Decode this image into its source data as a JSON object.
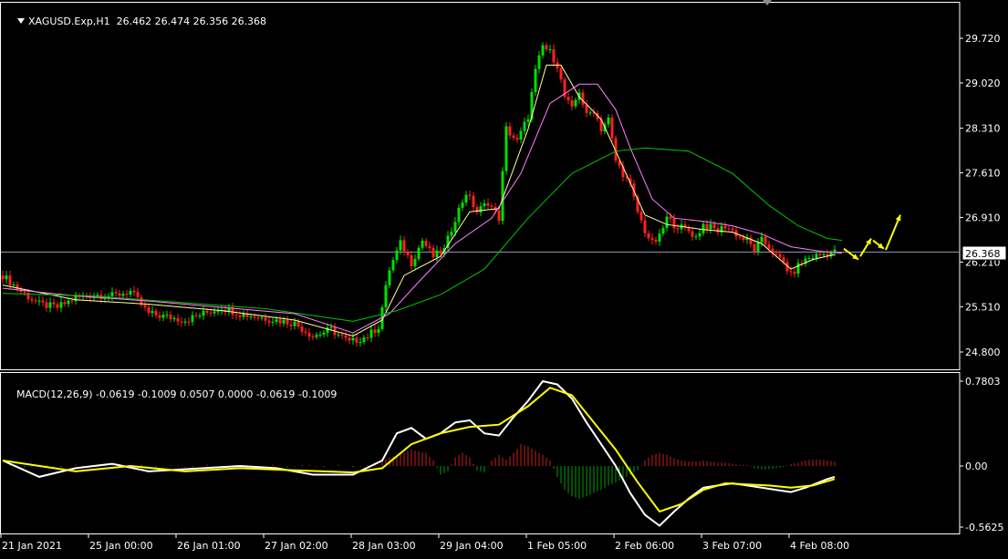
{
  "symbol_title": "XAGUSD.Exp,H1",
  "ohlc": "26.462 26.474 26.356 26.368",
  "macd_title": "MACD(12,26,9) -0.0619 -0.1009 0.0507 0.0000 -0.0619 -0.1009",
  "current_price": "26.368",
  "colors": {
    "background": "#000000",
    "bull_candle": "#00e000",
    "bear_candle": "#ff2020",
    "ma_fast": "#ffffa0",
    "ma_mid": "#ff80ff",
    "ma_slow": "#00c800",
    "macd_line": "#ffffff",
    "signal_line": "#ffff00",
    "hist_up": "#c81e1e",
    "hist_down": "#00a000",
    "forecast_arrow": "#ffff00",
    "price_line": "#8fa0b0"
  },
  "chart_data": [
    {
      "type": "candlestick",
      "title": "XAGUSD.Exp,H1",
      "y_ticks": [
        "29.720",
        "29.020",
        "28.310",
        "27.610",
        "26.910",
        "26.210",
        "25.510",
        "24.800"
      ],
      "ylim": [
        24.59,
        30.11
      ],
      "x_ticks": [
        "21 Jan 2021",
        "25 Jan 00:00",
        "26 Jan 01:00",
        "27 Jan 02:00",
        "28 Jan 03:00",
        "29 Jan 04:00",
        "1 Feb 05:00",
        "2 Feb 06:00",
        "3 Feb 07:00",
        "4 Feb 08:00"
      ],
      "x_tick_index": [
        0,
        24,
        48,
        72,
        96,
        120,
        144,
        168,
        192,
        216
      ],
      "close_path": [
        [
          0,
          26.0
        ],
        [
          5,
          25.75
        ],
        [
          10,
          25.55
        ],
        [
          15,
          25.5
        ],
        [
          20,
          25.65
        ],
        [
          25,
          25.7
        ],
        [
          30,
          25.68
        ],
        [
          35,
          25.75
        ],
        [
          40,
          25.4
        ],
        [
          45,
          25.35
        ],
        [
          50,
          25.3
        ],
        [
          55,
          25.4
        ],
        [
          60,
          25.5
        ],
        [
          65,
          25.4
        ],
        [
          70,
          25.35
        ],
        [
          75,
          25.3
        ],
        [
          80,
          25.25
        ],
        [
          85,
          25.05
        ],
        [
          90,
          25.15
        ],
        [
          95,
          24.95
        ],
        [
          100,
          25.05
        ],
        [
          103,
          25.2
        ],
        [
          106,
          26.1
        ],
        [
          109,
          26.5
        ],
        [
          112,
          26.2
        ],
        [
          115,
          26.55
        ],
        [
          118,
          26.3
        ],
        [
          121,
          26.4
        ],
        [
          124,
          26.9
        ],
        [
          127,
          27.3
        ],
        [
          130,
          27.0
        ],
        [
          133,
          27.15
        ],
        [
          136,
          26.9
        ],
        [
          138,
          28.3
        ],
        [
          141,
          28.1
        ],
        [
          144,
          28.5
        ],
        [
          146,
          29.2
        ],
        [
          148,
          29.6
        ],
        [
          150,
          29.5
        ],
        [
          152,
          29.3
        ],
        [
          154,
          28.8
        ],
        [
          156,
          28.6
        ],
        [
          158,
          28.9
        ],
        [
          160,
          28.5
        ],
        [
          162,
          28.6
        ],
        [
          164,
          28.3
        ],
        [
          166,
          28.45
        ],
        [
          168,
          27.8
        ],
        [
          170,
          27.6
        ],
        [
          172,
          27.4
        ],
        [
          174,
          27.0
        ],
        [
          176,
          26.7
        ],
        [
          178,
          26.5
        ],
        [
          180,
          26.6
        ],
        [
          182,
          26.9
        ],
        [
          184,
          26.8
        ],
        [
          186,
          26.75
        ],
        [
          188,
          26.7
        ],
        [
          190,
          26.6
        ],
        [
          192,
          26.8
        ],
        [
          194,
          26.75
        ],
        [
          196,
          26.7
        ],
        [
          198,
          26.78
        ],
        [
          200,
          26.7
        ],
        [
          202,
          26.6
        ],
        [
          204,
          26.55
        ],
        [
          206,
          26.4
        ],
        [
          208,
          26.55
        ],
        [
          210,
          26.45
        ],
        [
          212,
          26.3
        ],
        [
          214,
          26.2
        ],
        [
          216,
          26.0
        ],
        [
          218,
          26.15
        ],
        [
          220,
          26.25
        ],
        [
          222,
          26.3
        ],
        [
          224,
          26.32
        ],
        [
          226,
          26.35
        ],
        [
          228,
          26.368
        ]
      ],
      "moving_averages": [
        {
          "role": "fast",
          "points": [
            [
              0,
              25.85
            ],
            [
              20,
              25.62
            ],
            [
              40,
              25.55
            ],
            [
              60,
              25.45
            ],
            [
              80,
              25.3
            ],
            [
              96,
              25.05
            ],
            [
              104,
              25.3
            ],
            [
              110,
              26.0
            ],
            [
              120,
              26.3
            ],
            [
              128,
              27.0
            ],
            [
              136,
              27.05
            ],
            [
              144,
              28.3
            ],
            [
              149,
              29.3
            ],
            [
              153,
              29.3
            ],
            [
              158,
              28.8
            ],
            [
              164,
              28.45
            ],
            [
              170,
              27.7
            ],
            [
              176,
              26.95
            ],
            [
              182,
              26.8
            ],
            [
              192,
              26.72
            ],
            [
              200,
              26.68
            ],
            [
              208,
              26.5
            ],
            [
              216,
              26.1
            ],
            [
              222,
              26.25
            ],
            [
              228,
              26.33
            ]
          ]
        },
        {
          "role": "mid",
          "points": [
            [
              0,
              25.8
            ],
            [
              20,
              25.68
            ],
            [
              40,
              25.6
            ],
            [
              60,
              25.5
            ],
            [
              80,
              25.4
            ],
            [
              96,
              25.1
            ],
            [
              106,
              25.4
            ],
            [
              114,
              25.9
            ],
            [
              124,
              26.5
            ],
            [
              134,
              26.9
            ],
            [
              142,
              27.6
            ],
            [
              150,
              28.7
            ],
            [
              158,
              29.0
            ],
            [
              163,
              29.0
            ],
            [
              168,
              28.6
            ],
            [
              172,
              28.0
            ],
            [
              178,
              27.2
            ],
            [
              184,
              26.9
            ],
            [
              192,
              26.85
            ],
            [
              200,
              26.78
            ],
            [
              208,
              26.65
            ],
            [
              216,
              26.45
            ],
            [
              224,
              26.38
            ],
            [
              230,
              26.35
            ]
          ]
        },
        {
          "role": "slow",
          "points": [
            [
              0,
              25.72
            ],
            [
              24,
              25.68
            ],
            [
              48,
              25.58
            ],
            [
              72,
              25.48
            ],
            [
              96,
              25.28
            ],
            [
              108,
              25.45
            ],
            [
              120,
              25.7
            ],
            [
              132,
              26.1
            ],
            [
              144,
              26.9
            ],
            [
              156,
              27.6
            ],
            [
              168,
              27.95
            ],
            [
              176,
              28.0
            ],
            [
              188,
              27.95
            ],
            [
              200,
              27.6
            ],
            [
              210,
              27.1
            ],
            [
              218,
              26.78
            ],
            [
              226,
              26.58
            ],
            [
              230,
              26.55
            ]
          ]
        }
      ],
      "forecast_arrows": [
        {
          "from": [
            230.5,
            26.42
          ],
          "to": [
            234.5,
            26.25
          ]
        },
        {
          "from": [
            235,
            26.3
          ],
          "to": [
            238,
            26.58
          ]
        },
        {
          "from": [
            238.5,
            26.55
          ],
          "to": [
            241.5,
            26.42
          ]
        },
        {
          "from": [
            242,
            26.4
          ],
          "to": [
            246,
            26.95
          ]
        }
      ]
    },
    {
      "type": "line",
      "title": "MACD(12,26,9)",
      "y_ticks": [
        "0.7803",
        "0.00",
        "-0.5625"
      ],
      "ylim": [
        -0.6196,
        0.8374
      ],
      "series": [
        {
          "role": "macd",
          "points": [
            [
              0,
              0.05
            ],
            [
              10,
              -0.1
            ],
            [
              20,
              -0.02
            ],
            [
              30,
              0.02
            ],
            [
              40,
              -0.05
            ],
            [
              55,
              -0.02
            ],
            [
              65,
              0.0
            ],
            [
              75,
              -0.02
            ],
            [
              85,
              -0.08
            ],
            [
              96,
              -0.08
            ],
            [
              104,
              0.05
            ],
            [
              108,
              0.3
            ],
            [
              112,
              0.35
            ],
            [
              116,
              0.25
            ],
            [
              120,
              0.3
            ],
            [
              124,
              0.4
            ],
            [
              128,
              0.42
            ],
            [
              132,
              0.3
            ],
            [
              136,
              0.28
            ],
            [
              140,
              0.45
            ],
            [
              144,
              0.6
            ],
            [
              148,
              0.78
            ],
            [
              152,
              0.75
            ],
            [
              156,
              0.62
            ],
            [
              160,
              0.4
            ],
            [
              164,
              0.2
            ],
            [
              168,
              0.0
            ],
            [
              172,
              -0.25
            ],
            [
              176,
              -0.45
            ],
            [
              180,
              -0.55
            ],
            [
              184,
              -0.42
            ],
            [
              188,
              -0.3
            ],
            [
              192,
              -0.2
            ],
            [
              196,
              -0.18
            ],
            [
              200,
              -0.16
            ],
            [
              204,
              -0.18
            ],
            [
              208,
              -0.2
            ],
            [
              212,
              -0.22
            ],
            [
              216,
              -0.24
            ],
            [
              220,
              -0.2
            ],
            [
              226,
              -0.12
            ],
            [
              228,
              -0.1
            ]
          ]
        },
        {
          "role": "signal",
          "points": [
            [
              0,
              0.05
            ],
            [
              20,
              -0.05
            ],
            [
              35,
              0.0
            ],
            [
              50,
              -0.05
            ],
            [
              65,
              -0.02
            ],
            [
              80,
              -0.04
            ],
            [
              96,
              -0.06
            ],
            [
              104,
              -0.02
            ],
            [
              112,
              0.2
            ],
            [
              120,
              0.3
            ],
            [
              128,
              0.36
            ],
            [
              136,
              0.38
            ],
            [
              144,
              0.55
            ],
            [
              150,
              0.72
            ],
            [
              156,
              0.65
            ],
            [
              162,
              0.4
            ],
            [
              168,
              0.15
            ],
            [
              174,
              -0.15
            ],
            [
              180,
              -0.42
            ],
            [
              186,
              -0.35
            ],
            [
              192,
              -0.22
            ],
            [
              198,
              -0.16
            ],
            [
              204,
              -0.17
            ],
            [
              210,
              -0.18
            ],
            [
              216,
              -0.2
            ],
            [
              222,
              -0.18
            ],
            [
              228,
              -0.12
            ]
          ]
        }
      ],
      "histogram": [
        [
          104,
          0.05
        ],
        [
          108,
          0.1
        ],
        [
          112,
          0.15
        ],
        [
          116,
          0.12
        ],
        [
          118,
          0.05
        ],
        [
          120,
          -0.08
        ],
        [
          122,
          -0.05
        ],
        [
          124,
          0.08
        ],
        [
          126,
          0.12
        ],
        [
          128,
          0.08
        ],
        [
          130,
          -0.04
        ],
        [
          132,
          -0.06
        ],
        [
          134,
          0.05
        ],
        [
          136,
          0.1
        ],
        [
          138,
          0.06
        ],
        [
          140,
          0.12
        ],
        [
          142,
          0.2
        ],
        [
          144,
          0.18
        ],
        [
          146,
          0.14
        ],
        [
          148,
          0.1
        ],
        [
          150,
          0.05
        ],
        [
          152,
          -0.1
        ],
        [
          154,
          -0.22
        ],
        [
          156,
          -0.28
        ],
        [
          158,
          -0.3
        ],
        [
          160,
          -0.28
        ],
        [
          162,
          -0.25
        ],
        [
          164,
          -0.22
        ],
        [
          166,
          -0.18
        ],
        [
          168,
          -0.15
        ],
        [
          170,
          -0.12
        ],
        [
          172,
          -0.08
        ],
        [
          174,
          -0.04
        ],
        [
          176,
          0.05
        ],
        [
          178,
          0.1
        ],
        [
          180,
          0.12
        ],
        [
          182,
          0.1
        ],
        [
          184,
          0.07
        ],
        [
          186,
          0.05
        ],
        [
          188,
          0.04
        ],
        [
          190,
          0.04
        ],
        [
          192,
          0.05
        ],
        [
          194,
          0.04
        ],
        [
          196,
          0.03
        ],
        [
          198,
          0.03
        ],
        [
          200,
          0.02
        ],
        [
          202,
          0.01
        ],
        [
          204,
          0.01
        ],
        [
          206,
          -0.02
        ],
        [
          208,
          -0.03
        ],
        [
          210,
          -0.03
        ],
        [
          212,
          -0.02
        ],
        [
          214,
          -0.01
        ],
        [
          216,
          0.02
        ],
        [
          218,
          0.03
        ],
        [
          220,
          0.05
        ],
        [
          222,
          0.06
        ],
        [
          224,
          0.06
        ],
        [
          226,
          0.05
        ],
        [
          228,
          0.04
        ]
      ]
    }
  ]
}
